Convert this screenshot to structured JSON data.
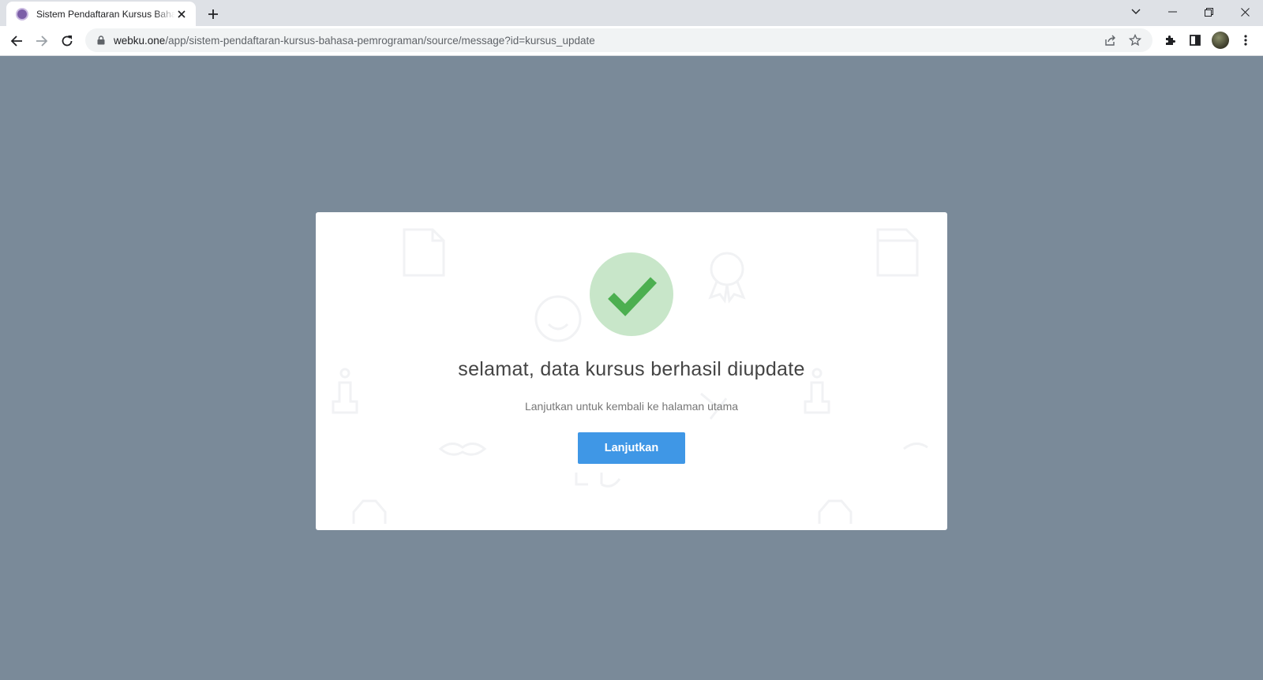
{
  "browser": {
    "tab_title": "Sistem Pendaftaran Kursus Bahasa Pemrograman",
    "url_host": "webku.one",
    "url_path": "/app/sistem-pendaftaran-kursus-bahasa-pemrograman/source/message?id=kursus_update"
  },
  "message": {
    "title": "selamat, data kursus berhasil diupdate",
    "subtitle": "Lanjutkan untuk kembali ke halaman utama",
    "button_label": "Lanjutkan"
  },
  "colors": {
    "page_bg": "#7a8a99",
    "success_circle": "#c8e6c9",
    "success_check": "#4caf50",
    "button_bg": "#3f97e6"
  }
}
